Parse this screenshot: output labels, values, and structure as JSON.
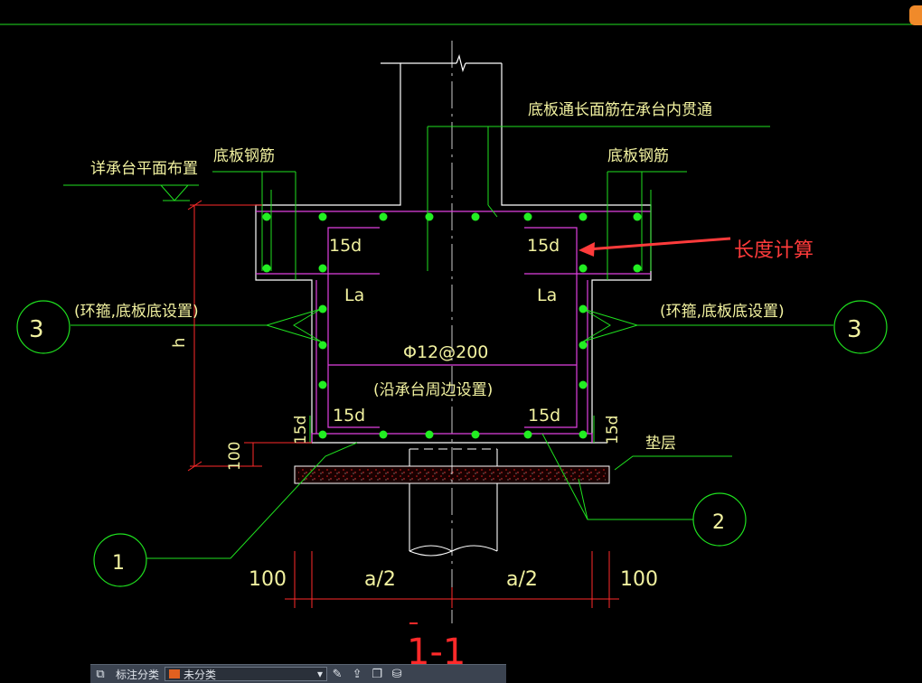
{
  "colors": {
    "background": "#000000",
    "line_green": "#1fe01f",
    "line_white": "#ffffff",
    "line_magenta": "#e040e0",
    "line_red": "#ff2a2a",
    "rebar_dot": "#22ee22",
    "text_yellow": "#f2f2a0",
    "annotation_red": "#ff3b3b",
    "toolbar_bg": "#3b4350",
    "toolbar_swatch": "#e06020"
  },
  "drawing": {
    "note_top_right": "底板通长面筋在承台内贯通",
    "label_floor_rebar_left": "底板钢筋",
    "label_floor_rebar_right": "底板钢筋",
    "label_cap_plan": "详承台平面布置",
    "label_hoop_left": "(环箍,底板底设置)",
    "label_hoop_right": "(环箍,底板底设置)",
    "label_perimeter": "(沿承台周边设置)",
    "rebar_spec": "Φ12@200",
    "label_15d_tl": "15d",
    "label_15d_tr": "15d",
    "label_15d_bl": "15d",
    "label_15d_br": "15d",
    "label_15d_left_vert": "15d",
    "label_15d_right_vert": "15d",
    "label_la_left": "La",
    "label_la_right": "La",
    "label_h": "h",
    "label_100_vert": "100",
    "label_cushion": "垫层",
    "dim_100_left": "100",
    "dim_a2_left": "a/2",
    "dim_a2_right": "a/2",
    "dim_100_right": "100",
    "section_mark": "1-1",
    "callout_1": "1",
    "callout_2": "2",
    "callout_3_left": "3",
    "callout_3_right": "3",
    "annotation": "长度计算"
  },
  "toolbar": {
    "label": "标注分类",
    "selected": "未分类",
    "icons": [
      "layers-icon",
      "pencil-icon",
      "upload-icon",
      "copy-icon",
      "save-icon"
    ]
  }
}
